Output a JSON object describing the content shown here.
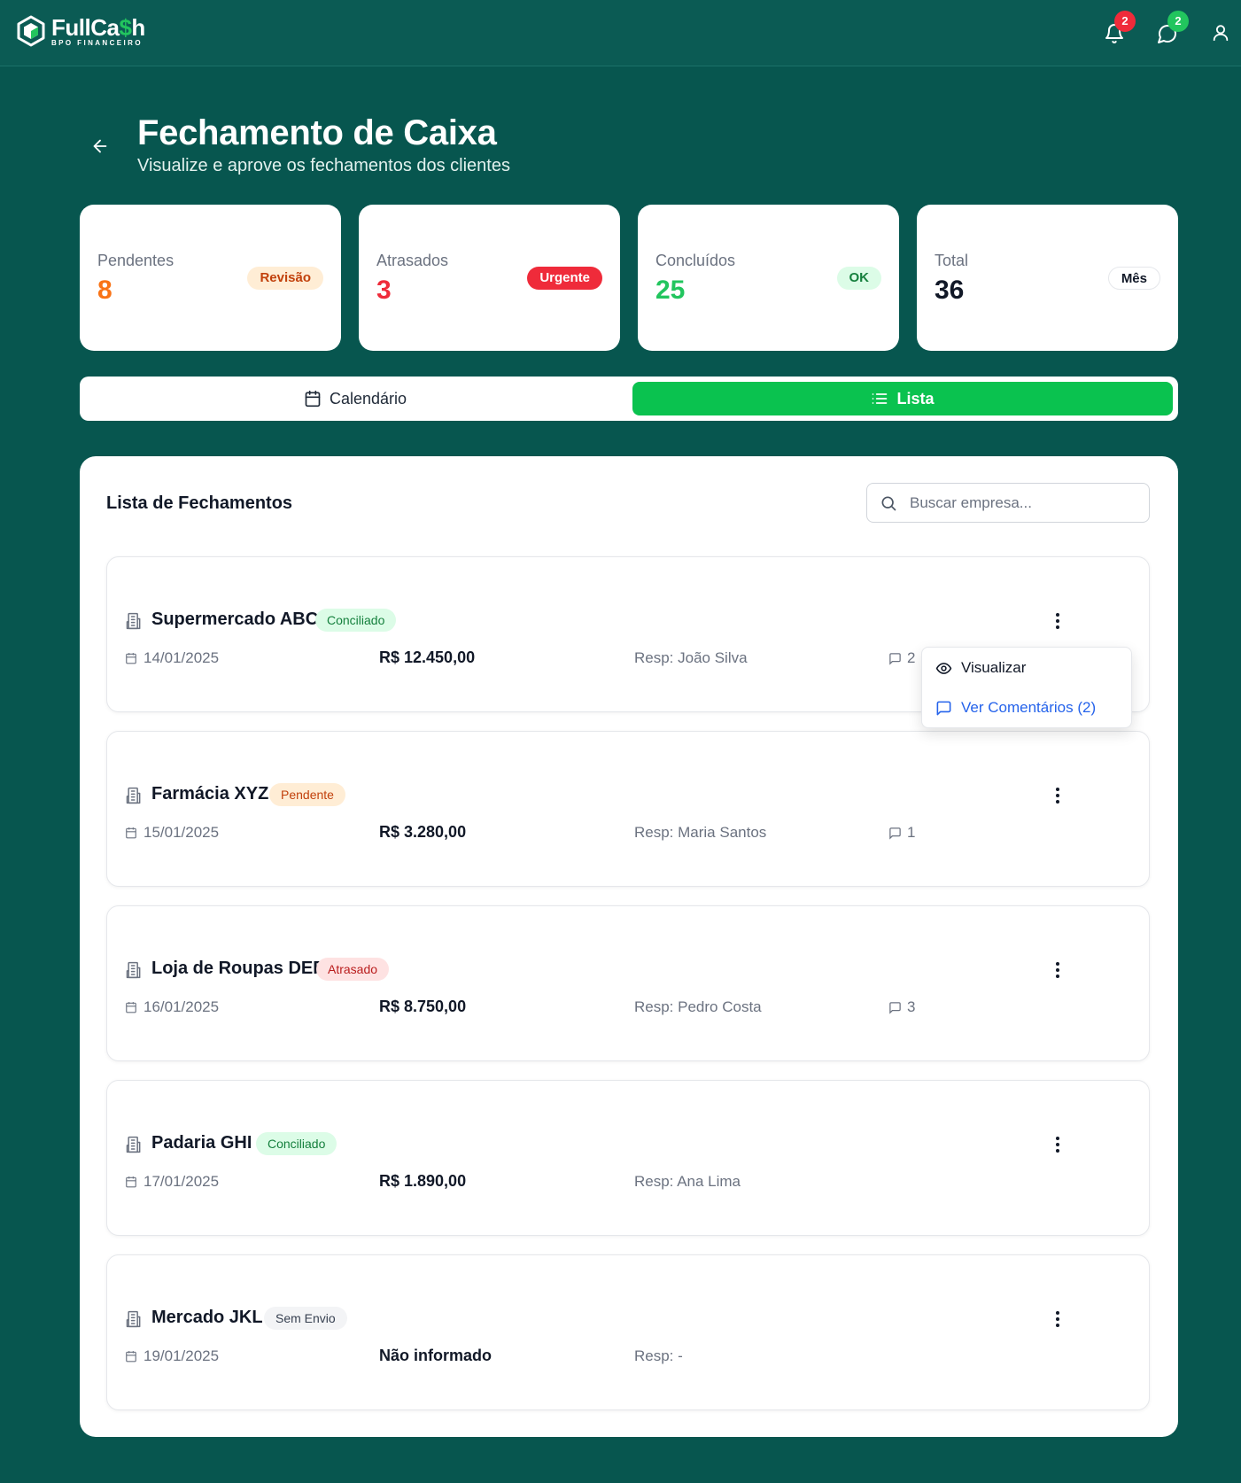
{
  "brand": {
    "name_main": "FullCa",
    "name_accent": "$",
    "name_end": "h",
    "tagline": "BPO FINANCEIRO"
  },
  "topbar": {
    "notifications_count": "2",
    "messages_count": "2"
  },
  "header": {
    "title": "Fechamento de Caixa",
    "subtitle": "Visualize e aprove os fechamentos dos clientes"
  },
  "stats": [
    {
      "label": "Pendentes",
      "value": "8",
      "pill": "Revisão",
      "value_color": "#f97316"
    },
    {
      "label": "Atrasados",
      "value": "3",
      "pill": "Urgente",
      "value_color": "#ef2b3a"
    },
    {
      "label": "Concluídos",
      "value": "25",
      "pill": "OK",
      "value_color": "#22c55e"
    },
    {
      "label": "Total",
      "value": "36",
      "pill": "Mês",
      "value_color": "#111827"
    }
  ],
  "view_toggle": {
    "calendar_label": "Calendário",
    "list_label": "Lista",
    "active": "list"
  },
  "list": {
    "title": "Lista de Fechamentos",
    "search_placeholder": "Buscar empresa...",
    "rows": [
      {
        "name": "Supermercado ABC",
        "status": "Conciliado",
        "date": "14/01/2025",
        "amount": "R$ 12.450,00",
        "resp": "Resp: João Silva",
        "comments": "2"
      },
      {
        "name": "Farmácia XYZ",
        "status": "Pendente",
        "date": "15/01/2025",
        "amount": "R$ 3.280,00",
        "resp": "Resp: Maria Santos",
        "comments": "1"
      },
      {
        "name": "Loja de Roupas DEF",
        "status": "Atrasado",
        "date": "16/01/2025",
        "amount": "R$ 8.750,00",
        "resp": "Resp: Pedro Costa",
        "comments": "3"
      },
      {
        "name": "Padaria GHI",
        "status": "Conciliado",
        "date": "17/01/2025",
        "amount": "R$ 1.890,00",
        "resp": "Resp: Ana Lima",
        "comments": ""
      },
      {
        "name": "Mercado JKL",
        "status": "Sem Envio",
        "date": "19/01/2025",
        "amount": "Não informado",
        "resp": "Resp: -",
        "comments": ""
      }
    ]
  },
  "row_menu": {
    "view_label": "Visualizar",
    "comments_label": "Ver Comentários (2)"
  },
  "colors": {
    "background": "#07564f",
    "accent_green": "#0ac24f",
    "link_blue": "#2563eb",
    "danger_red": "#ef2b3a"
  }
}
